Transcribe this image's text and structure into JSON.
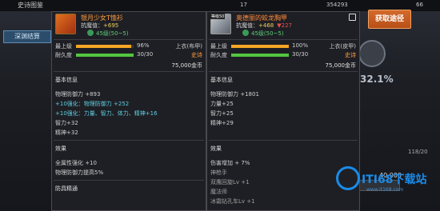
{
  "background": {
    "back_title": "史诗图鉴",
    "tab": "深渊结算",
    "currency_left": "17",
    "currency_mid": "354293",
    "currency_right": "66",
    "get_button": "获取途径",
    "percent": "32.1%",
    "count": "118/20",
    "amount": "40,000"
  },
  "left": {
    "name": "银月少女T恤衫",
    "resistance_label": "抗魔值：",
    "resistance_value": "+695",
    "level_range": "45级(50~5)",
    "top_label": "最上级",
    "top_pct": "96%",
    "top_fill": 0.96,
    "durability_label": "耐久度",
    "durability": "30/30",
    "slot": "上衣(布甲)",
    "rarity": "史诗",
    "price": "75,000金币",
    "basic_title": "基本信息",
    "phys_def": "物理防御力 +893",
    "enhance1": "+10强化：物理防御力 +252",
    "enhance2": "+10强化：力量、智力、体力、精神+16",
    "int": "智力+32",
    "spirit": "精神+32",
    "effect_title": "效果",
    "effect1": "全属性强化 +10",
    "effect2": "物理防御力提高5%",
    "footer": "防具精通"
  },
  "right": {
    "level_tag": "等级50",
    "name": "奥德丽的蛟龙胸甲",
    "resistance_label": "抗魔值：",
    "resistance_value": "+468",
    "resistance_diff": "▼227",
    "level_range": "45级(50~5)",
    "top_label": "最上级",
    "top_pct": "100%",
    "top_fill": 1.0,
    "durability_label": "耐久度",
    "durability": "30/30",
    "slot": "上衣(皮甲)",
    "rarity": "史诗",
    "price": "75,000金币",
    "basic_title": "基本信息",
    "phys_def": "物理防御力 +1801",
    "str": "力量+25",
    "int": "智力+25",
    "spirit": "精神+29",
    "effect_title": "效果",
    "effect1": "伤害增加 + 7%",
    "effect2": "神枪手",
    "effect3": "双鹰回旋Lv +1",
    "effect4": "魔法师",
    "effect5": "冰霜钻孔车Lv +1"
  },
  "watermark": {
    "brand": "ITI68下载站",
    "url": "www.it168.com"
  },
  "colors": {
    "bar_orange": "#f5a623",
    "bar_green": "#53c640",
    "epic": "#ff9b3d",
    "enhance": "#5ecde0"
  }
}
